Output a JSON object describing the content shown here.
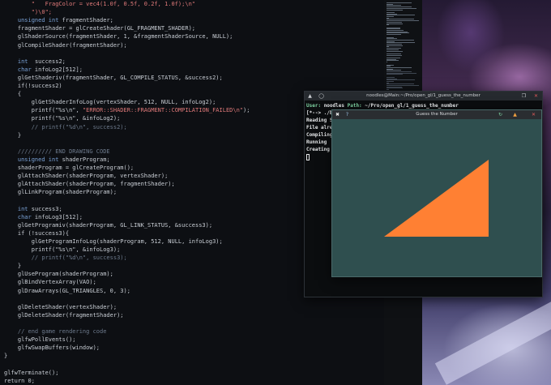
{
  "editor": {
    "lines": [
      [
        {
          "t": "        \"   FragColor = vec4(1.0f, 0.5f, 0.2f, 1.0f);\\n\"",
          "c": "str"
        }
      ],
      [
        {
          "t": "        \")\\0\";",
          "c": "str"
        }
      ],
      [
        {
          "t": "    ",
          "c": ""
        },
        {
          "t": "unsigned int",
          "c": "type"
        },
        {
          "t": " fragmentShader;",
          "c": ""
        }
      ],
      [
        {
          "t": "    fragmentShader = glCreateShader(GL_FRAGMENT_SHADER);",
          "c": ""
        }
      ],
      [
        {
          "t": "    glShaderSource(fragmentShader, 1, &fragmentShaderSource, NULL);",
          "c": ""
        }
      ],
      [
        {
          "t": "    glCompileShader(fragmentShader);",
          "c": ""
        }
      ],
      [
        {
          "t": "",
          "c": ""
        }
      ],
      [
        {
          "t": "    ",
          "c": ""
        },
        {
          "t": "int",
          "c": "type"
        },
        {
          "t": "  success2;",
          "c": ""
        }
      ],
      [
        {
          "t": "    ",
          "c": ""
        },
        {
          "t": "char",
          "c": "type"
        },
        {
          "t": " infoLog2[512];",
          "c": ""
        }
      ],
      [
        {
          "t": "    glGetShaderiv(fragmentShader, GL_COMPILE_STATUS, &success2);",
          "c": ""
        }
      ],
      [
        {
          "t": "    if(!success2)",
          "c": ""
        }
      ],
      [
        {
          "t": "    {",
          "c": ""
        }
      ],
      [
        {
          "t": "        glGetShaderInfoLog(vertexShader, 512, NULL, infoLog2);",
          "c": ""
        }
      ],
      [
        {
          "t": "        printf(\"%s\\n\", ",
          "c": ""
        },
        {
          "t": "\"ERROR::SHADER::FRAGMENT::COMPILATION_FAILED\\n\"",
          "c": "str"
        },
        {
          "t": ");",
          "c": ""
        }
      ],
      [
        {
          "t": "        printf(\"%s\\n\", &infoLog2);",
          "c": ""
        }
      ],
      [
        {
          "t": "        // printf(\"%d\\n\", success2);",
          "c": "cmt"
        }
      ],
      [
        {
          "t": "    }",
          "c": ""
        }
      ],
      [
        {
          "t": "",
          "c": ""
        }
      ],
      [
        {
          "t": "    ////////// END DRAWING CODE",
          "c": "cmt"
        }
      ],
      [
        {
          "t": "    ",
          "c": ""
        },
        {
          "t": "unsigned int",
          "c": "type"
        },
        {
          "t": " shaderProgram;",
          "c": ""
        }
      ],
      [
        {
          "t": "    shaderProgram = glCreateProgram();",
          "c": ""
        }
      ],
      [
        {
          "t": "    glAttachShader(shaderProgram, vertexShader);",
          "c": ""
        }
      ],
      [
        {
          "t": "    glAttachShader(shaderProgram, fragmentShader);",
          "c": ""
        }
      ],
      [
        {
          "t": "    glLinkProgram(shaderProgram);",
          "c": ""
        }
      ],
      [
        {
          "t": "",
          "c": ""
        }
      ],
      [
        {
          "t": "    ",
          "c": ""
        },
        {
          "t": "int",
          "c": "type"
        },
        {
          "t": " success3;",
          "c": ""
        }
      ],
      [
        {
          "t": "    ",
          "c": ""
        },
        {
          "t": "char",
          "c": "type"
        },
        {
          "t": " infoLog3[512];",
          "c": ""
        }
      ],
      [
        {
          "t": "    glGetProgramiv(shaderProgram, GL_LINK_STATUS, &success3);",
          "c": ""
        }
      ],
      [
        {
          "t": "    if (!success3){",
          "c": ""
        }
      ],
      [
        {
          "t": "        glGetProgramInfoLog(shaderProgram, 512, NULL, infoLog3);",
          "c": ""
        }
      ],
      [
        {
          "t": "        printf(\"%s\\n\", &infoLog3);",
          "c": ""
        }
      ],
      [
        {
          "t": "        // printf(\"%d\\n\", success3);",
          "c": "cmt"
        }
      ],
      [
        {
          "t": "    }",
          "c": ""
        }
      ],
      [
        {
          "t": "    glUseProgram(shaderProgram);",
          "c": ""
        }
      ],
      [
        {
          "t": "    glBindVertexArray(VAO);",
          "c": ""
        }
      ],
      [
        {
          "t": "    glDrawArrays(GL_TRIANGLES, 0, 3);",
          "c": ""
        }
      ],
      [
        {
          "t": "",
          "c": ""
        }
      ],
      [
        {
          "t": "    glDeleteShader(vertexShader);",
          "c": ""
        }
      ],
      [
        {
          "t": "    glDeleteShader(fragmentShader);",
          "c": ""
        }
      ],
      [
        {
          "t": "",
          "c": ""
        }
      ],
      [
        {
          "t": "    // end game rendering code",
          "c": "cmt"
        }
      ],
      [
        {
          "t": "    glfwPollEvents();",
          "c": ""
        }
      ],
      [
        {
          "t": "    glfwSwapBuffers(window);",
          "c": ""
        }
      ],
      [
        {
          "t": "}",
          "c": ""
        }
      ],
      [
        {
          "t": "",
          "c": ""
        }
      ],
      [
        {
          "t": "glfwTerminate();",
          "c": ""
        }
      ],
      [
        {
          "t": "return 0;",
          "c": ""
        }
      ]
    ]
  },
  "terminal": {
    "title": "noodles@Main:~/Pro/open_gl/1_guess_the_number",
    "icon_left": "terminal-icon",
    "icon_pin": "pin-icon",
    "icon_close": "close-icon",
    "lines": {
      "user_label": "User:",
      "user": "noodles",
      "path_label": "Path:",
      "path": "~/Pro/open_gl/1_guess_the_number",
      "prompt": "[*--> ./b",
      "line3": "Reading S",
      "line4": "File alre",
      "line5": "Compiling",
      "line6": "Running",
      "line7": "Creating"
    }
  },
  "glwindow": {
    "title": "Guess the Number",
    "app_icon": "x-app-icon",
    "help_icon": "help-icon",
    "refresh_icon": "refresh-icon",
    "warn_icon": "warning-icon",
    "close_icon": "close-icon",
    "clear_color": "#2f4f4f",
    "triangle_color": "#ff8033"
  }
}
